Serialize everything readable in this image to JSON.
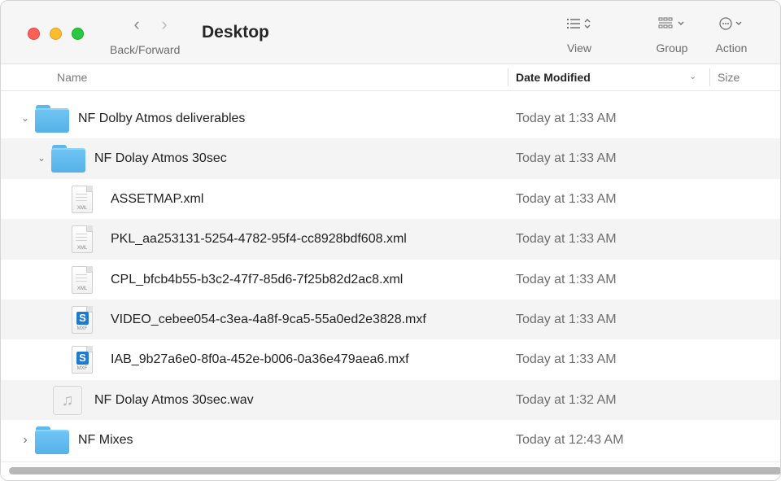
{
  "toolbar": {
    "title": "Desktop",
    "nav_caption": "Back/Forward",
    "back_glyph": "‹",
    "forward_glyph": "›",
    "view_label": "View",
    "view_icon": "list-view-icon",
    "group_label": "Group",
    "group_icon": "group-grid-icon",
    "action_label": "Action",
    "action_icon": "ellipsis-circle-icon"
  },
  "columns": {
    "name": "Name",
    "date_modified": "Date Modified",
    "size": "Size"
  },
  "rows": [
    {
      "name": "NF Dolby Atmos deliverables",
      "date": "Today at 1:33 AM",
      "kind": "folder",
      "disclosure": "⌄"
    },
    {
      "name": "NF Dolay Atmos 30sec",
      "date": "Today at 1:33 AM",
      "kind": "folder",
      "disclosure": "⌄"
    },
    {
      "name": "ASSETMAP.xml",
      "date": "Today at 1:33 AM",
      "kind": "xml",
      "tag": "XML"
    },
    {
      "name": "PKL_aa253131-5254-4782-95f4-cc8928bdf608.xml",
      "date": "Today at 1:33 AM",
      "kind": "xml",
      "tag": "XML"
    },
    {
      "name": "CPL_bfcb4b55-b3c2-47f7-85d6-7f25b82d2ac8.xml",
      "date": "Today at 1:33 AM",
      "kind": "xml",
      "tag": "XML"
    },
    {
      "name": "VIDEO_cebee054-c3ea-4a8f-9ca5-55a0ed2e3828.mxf",
      "date": "Today at 1:33 AM",
      "kind": "mxf",
      "tag": "MXF"
    },
    {
      "name": "IAB_9b27a6e0-8f0a-452e-b006-0a36e479aea6.mxf",
      "date": "Today at 1:33 AM",
      "kind": "mxf",
      "tag": "MXF"
    },
    {
      "name": "NF Dolay Atmos 30sec.wav",
      "date": "Today at 1:32 AM",
      "kind": "audio"
    },
    {
      "name": "NF Mixes",
      "date": "Today at 12:43 AM",
      "kind": "folder",
      "disclosure": "›"
    }
  ],
  "colors": {
    "folder": "#5fb8ec",
    "mxf_badge": "#1e7bd0",
    "alt_row": "#f4f4f4"
  }
}
